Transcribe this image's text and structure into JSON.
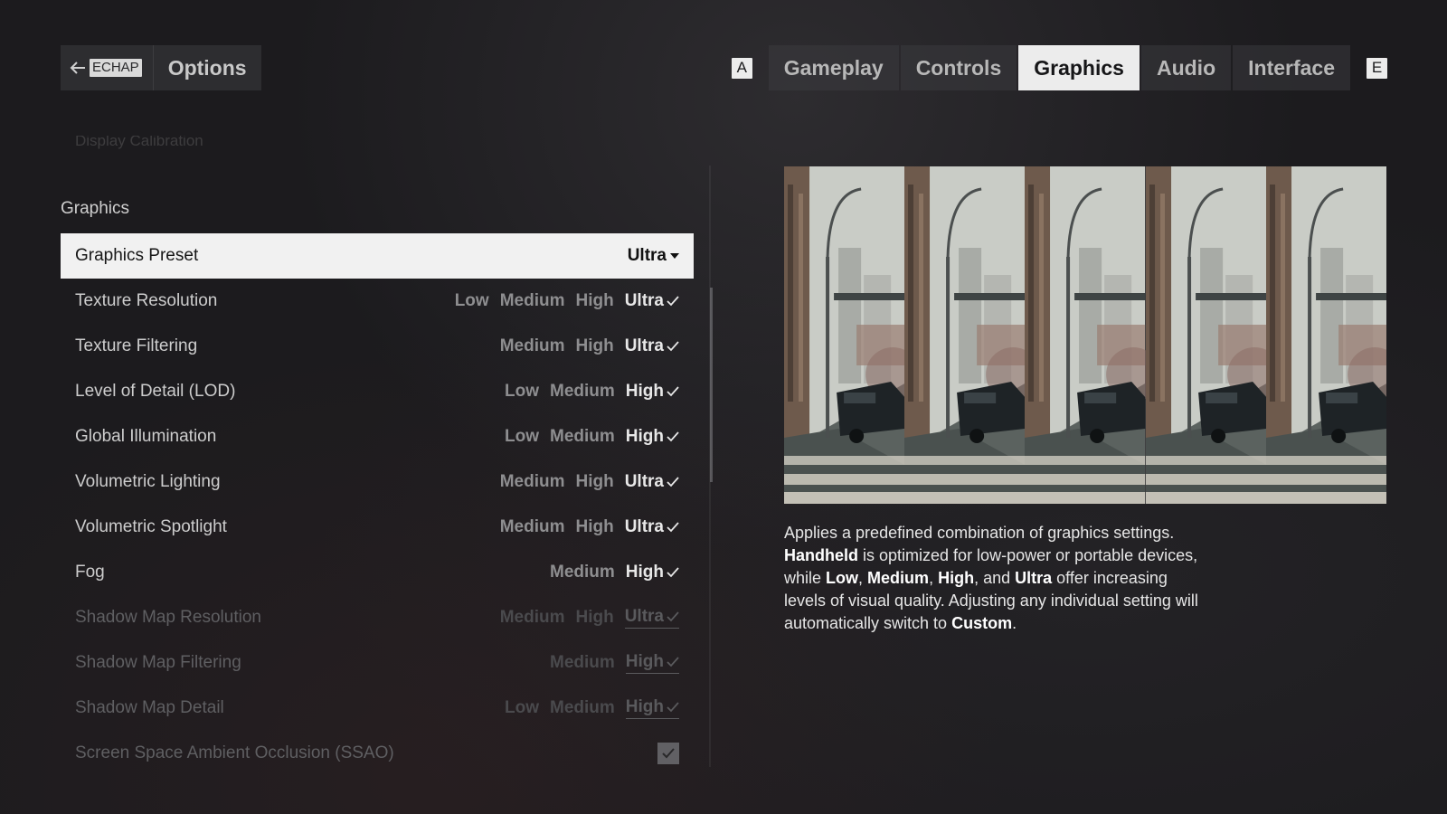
{
  "header": {
    "back_key": "ECHAP",
    "title": "Options"
  },
  "tabs": {
    "prev_key": "A",
    "next_key": "E",
    "items": [
      {
        "label": "Gameplay",
        "active": false
      },
      {
        "label": "Controls",
        "active": false
      },
      {
        "label": "Graphics",
        "active": true
      },
      {
        "label": "Audio",
        "active": false
      },
      {
        "label": "Interface",
        "active": false
      }
    ]
  },
  "settings": {
    "faded_item": "Display Calibration",
    "section_title": "Graphics",
    "preset": {
      "label": "Graphics Preset",
      "value": "Ultra"
    },
    "rows": [
      {
        "label": "Texture Resolution",
        "options": [
          "Low",
          "Medium",
          "High"
        ],
        "current": "Ultra",
        "disabled": false
      },
      {
        "label": "Texture Filtering",
        "options": [
          "Medium",
          "High"
        ],
        "current": "Ultra",
        "disabled": false
      },
      {
        "label": "Level of Detail (LOD)",
        "options": [
          "Low",
          "Medium"
        ],
        "current": "High",
        "disabled": false
      },
      {
        "label": "Global Illumination",
        "options": [
          "Low",
          "Medium"
        ],
        "current": "High",
        "disabled": false
      },
      {
        "label": "Volumetric Lighting",
        "options": [
          "Medium",
          "High"
        ],
        "current": "Ultra",
        "disabled": false
      },
      {
        "label": "Volumetric Spotlight",
        "options": [
          "Medium",
          "High"
        ],
        "current": "Ultra",
        "disabled": false
      },
      {
        "label": "Fog",
        "options": [
          "Medium"
        ],
        "current": "High",
        "disabled": false
      },
      {
        "label": "Shadow Map Resolution",
        "options": [
          "Medium",
          "High"
        ],
        "current": "Ultra",
        "disabled": true
      },
      {
        "label": "Shadow Map Filtering",
        "options": [
          "Medium"
        ],
        "current": "High",
        "disabled": true
      },
      {
        "label": "Shadow Map Detail",
        "options": [
          "Low",
          "Medium"
        ],
        "current": "High",
        "disabled": true
      }
    ],
    "ssao": {
      "label": "Screen Space Ambient Occlusion (SSAO)",
      "checked": true,
      "disabled": true
    }
  },
  "description": {
    "p1": "Applies a predefined combination of graphics settings. ",
    "handheld": "Handheld",
    "p2": " is optimized for low-power or portable devices, while ",
    "low": "Low",
    "sep1": ", ",
    "medium": "Medium",
    "sep2": ", ",
    "high": "High",
    "sep3": ", and ",
    "ultra": "Ultra",
    "p3": " offer increasing levels of visual quality. Adjusting any individual setting will automatically switch to ",
    "custom": "Custom",
    "p4": "."
  },
  "preview": {
    "strips": 5,
    "colors": {
      "sky": "#c9ccc6",
      "building": "#6e5a4c",
      "road": "#5b625f",
      "crosswalk": "#d8d4c8",
      "car": "#1e2326"
    }
  }
}
